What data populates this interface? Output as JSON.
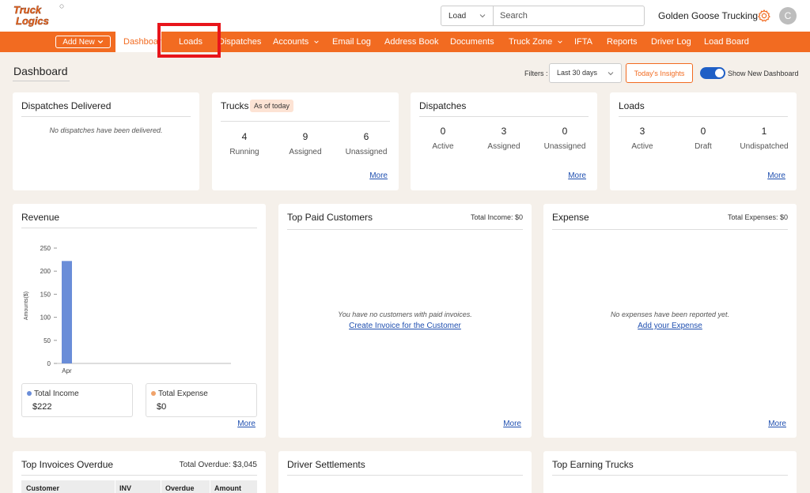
{
  "brand": {
    "logo_line1": "Truck",
    "logo_line2": "Logics",
    "accent": "#f26b21"
  },
  "search": {
    "type_value": "Load",
    "placeholder": "Search"
  },
  "header": {
    "company": "Golden Goose Trucking",
    "avatar_initial": "C"
  },
  "nav": {
    "add_new": "Add New",
    "items": [
      "Dashboard",
      "Loads",
      "Dispatches",
      "Accounts",
      "Email Log",
      "Address Book",
      "Documents",
      "Truck Zone",
      "IFTA",
      "Reports",
      "Driver Log",
      "Load Board"
    ]
  },
  "page": {
    "title": "Dashboard",
    "filters_label": "Filters :",
    "filter_value": "Last 30 days",
    "insights_button": "Today's Insights",
    "toggle_label": "Show New Dashboard"
  },
  "cards": {
    "dispatches_delivered": {
      "title": "Dispatches Delivered",
      "empty": "No dispatches have been delivered."
    },
    "trucks": {
      "title": "Trucks",
      "badge": "As of today",
      "stats": [
        {
          "value": "4",
          "label": "Running"
        },
        {
          "value": "9",
          "label": "Assigned"
        },
        {
          "value": "6",
          "label": "Unassigned"
        }
      ],
      "more": "More"
    },
    "dispatches": {
      "title": "Dispatches",
      "stats": [
        {
          "value": "0",
          "label": "Active"
        },
        {
          "value": "3",
          "label": "Assigned"
        },
        {
          "value": "0",
          "label": "Unassigned"
        }
      ],
      "more": "More"
    },
    "loads": {
      "title": "Loads",
      "stats": [
        {
          "value": "3",
          "label": "Active"
        },
        {
          "value": "0",
          "label": "Draft"
        },
        {
          "value": "1",
          "label": "Undispatched"
        }
      ],
      "more": "More"
    },
    "revenue": {
      "title": "Revenue",
      "legend": [
        {
          "name": "Total Income",
          "value": "$222",
          "color": "#6a8dd8"
        },
        {
          "name": "Total Expense",
          "value": "$0",
          "color": "#f0a36b"
        }
      ],
      "more": "More"
    },
    "top_paid_customers": {
      "title": "Top Paid Customers",
      "total": "Total Income: $0",
      "empty": "You have no customers with paid invoices.",
      "link": "Create Invoice for the Customer",
      "more": "More"
    },
    "expense": {
      "title": "Expense",
      "total": "Total Expenses: $0",
      "empty": "No expenses have been reported yet.",
      "link": "Add your Expense",
      "more": "More"
    },
    "top_invoices_overdue": {
      "title": "Top Invoices Overdue",
      "total": "Total Overdue: $3,045",
      "columns": [
        "Customer",
        "INV",
        "Overdue",
        "Amount"
      ]
    },
    "driver_settlements": {
      "title": "Driver Settlements"
    },
    "top_earning_trucks": {
      "title": "Top Earning Trucks"
    }
  },
  "chart_data": {
    "type": "bar",
    "categories": [
      "Apr"
    ],
    "series": [
      {
        "name": "Total Income",
        "values": [
          222
        ]
      }
    ],
    "ylabel": "Amounts($)",
    "yticks": [
      0,
      50,
      100,
      150,
      200,
      250
    ],
    "ylim": [
      0,
      250
    ],
    "bar_color": "#6a8dd8"
  }
}
